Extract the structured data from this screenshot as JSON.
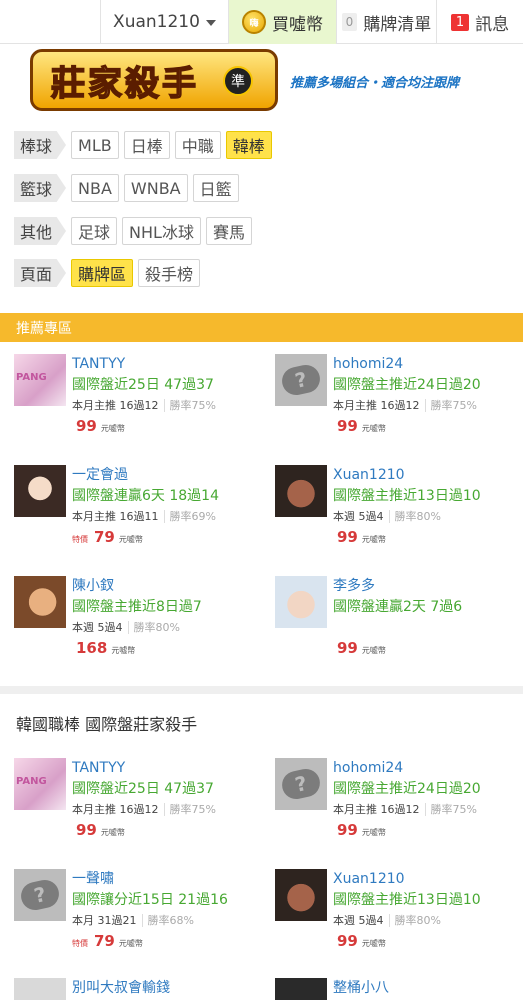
{
  "topbar": {
    "username": "Xuan1210",
    "coin_icon_text": "嗨",
    "buy_coin": "買噓幣",
    "cart_count": "0",
    "cart_label": "購牌清單",
    "msg_count": "1",
    "msg_label": "訊息"
  },
  "banner": {
    "logo_text": "莊家殺手",
    "logo_badge": "準",
    "tagline": "推薦多場組合・適合均注跟牌"
  },
  "categories": [
    {
      "label": "棒球",
      "items": [
        "MLB",
        "日棒",
        "中職",
        "韓棒"
      ],
      "active": "韓棒"
    },
    {
      "label": "籃球",
      "items": [
        "NBA",
        "WNBA",
        "日籃"
      ]
    },
    {
      "label": "其他",
      "items": [
        "足球",
        "NHL冰球",
        "賽馬"
      ]
    },
    {
      "label": "頁面",
      "items": [
        "購牌區",
        "殺手榜"
      ],
      "active": "購牌區"
    }
  ],
  "recommended": {
    "title": "推薦專區",
    "cards": [
      {
        "name": "TANTYY",
        "record": "國際盤近25日 47過37",
        "stats": "本月主推 16過12",
        "rate": "勝率75%",
        "price": "99",
        "unit": "元噓幣",
        "avatar": "pink-avatar"
      },
      {
        "name": "hohomi24",
        "record": "國際盤主推近24日過20",
        "stats": "本月主推 16過12",
        "rate": "勝率75%",
        "price": "99",
        "unit": "元噓幣",
        "avatar": "placeholder-avatar"
      },
      {
        "name": "一定會過",
        "record": "國際盤連贏6天 18過14",
        "stats": "本月主推 16過11",
        "rate": "勝率69%",
        "sale": "特價",
        "price": "79",
        "unit": "元噓幣",
        "avatar": "girl-avatar"
      },
      {
        "name": "Xuan1210",
        "record": "國際盤主推近13日過10",
        "stats": "本週 5過4",
        "rate": "勝率80%",
        "price": "99",
        "unit": "元噓幣",
        "avatar": "man-avatar"
      },
      {
        "name": "陳小釵",
        "record": "國際盤主推近8日過7",
        "stats": "本週 5過4",
        "rate": "勝率80%",
        "price": "168",
        "unit": "元噓幣",
        "avatar": "baby-avatar"
      },
      {
        "name": "李多多",
        "record": "國際盤連贏2天 7過6",
        "price": "99",
        "unit": "元噓幣",
        "avatar": "baby-avatar-2"
      }
    ]
  },
  "section2": {
    "title": "韓國職棒 國際盤莊家殺手",
    "cards": [
      {
        "name": "TANTYY",
        "record": "國際盤近25日 47過37",
        "stats": "本月主推 16過12",
        "rate": "勝率75%",
        "price": "99",
        "unit": "元噓幣",
        "avatar": "pink-avatar"
      },
      {
        "name": "hohomi24",
        "record": "國際盤主推近24日過20",
        "stats": "本月主推 16過12",
        "rate": "勝率75%",
        "price": "99",
        "unit": "元噓幣",
        "avatar": "placeholder-avatar"
      },
      {
        "name": "一聲嘯",
        "record": "國際讓分近15日 21過16",
        "stats": "本月 31過21",
        "rate": "勝率68%",
        "sale": "特價",
        "price": "79",
        "unit": "元噓幣",
        "avatar": "placeholder-avatar"
      },
      {
        "name": "Xuan1210",
        "record": "國際盤主推近13日過10",
        "stats": "本週 5過4",
        "rate": "勝率80%",
        "price": "99",
        "unit": "元噓幣",
        "avatar": "man-avatar"
      },
      {
        "name": "別叫大叔會輸錢",
        "avatar": "uncle-avatar"
      },
      {
        "name": "整桶小八",
        "avatar": "dark-avatar"
      }
    ]
  }
}
